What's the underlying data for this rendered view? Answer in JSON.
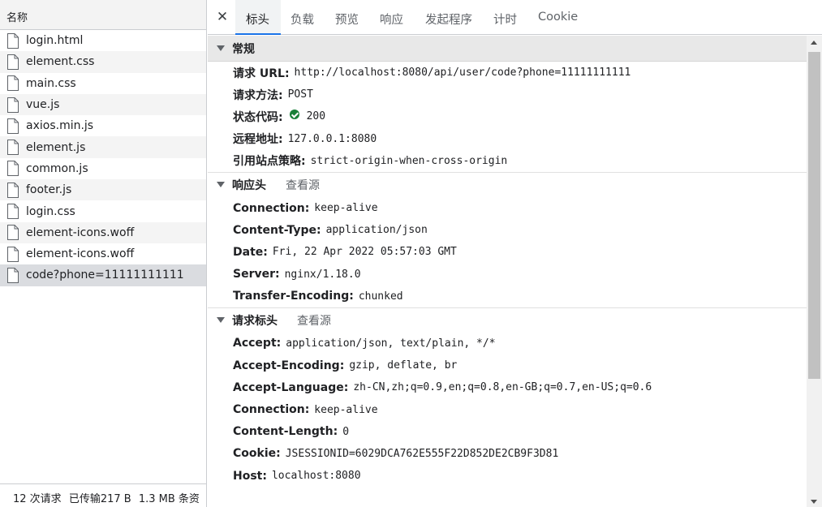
{
  "list": {
    "header": "名称",
    "files": [
      {
        "name": "login.html"
      },
      {
        "name": "element.css"
      },
      {
        "name": "main.css"
      },
      {
        "name": "vue.js"
      },
      {
        "name": "axios.min.js"
      },
      {
        "name": "element.js"
      },
      {
        "name": "common.js"
      },
      {
        "name": "footer.js"
      },
      {
        "name": "login.css"
      },
      {
        "name": "element-icons.woff"
      },
      {
        "name": "element-icons.woff"
      },
      {
        "name": "code?phone=11111111111"
      }
    ],
    "selected_index": 11,
    "status": {
      "requests": "12 次请求",
      "transferred": "已传输217 B",
      "resources": "1.3 MB 条资"
    }
  },
  "tabs": {
    "close_icon": "close-icon",
    "items": [
      {
        "label": "标头"
      },
      {
        "label": "负载"
      },
      {
        "label": "预览"
      },
      {
        "label": "响应"
      },
      {
        "label": "发起程序"
      },
      {
        "label": "计时"
      },
      {
        "label": "Cookie"
      }
    ],
    "active_index": 0
  },
  "general": {
    "title": "常规",
    "rows": [
      {
        "key": "请求 URL:",
        "value": "http://localhost:8080/api/user/code?phone=11111111111"
      },
      {
        "key": "请求方法:",
        "value": "POST"
      },
      {
        "key": "状态代码:",
        "value": "200",
        "icon": "status-ok-icon"
      },
      {
        "key": "远程地址:",
        "value": "127.0.0.1:8080"
      },
      {
        "key": "引用站点策略:",
        "value": "strict-origin-when-cross-origin"
      }
    ]
  },
  "response_headers": {
    "title": "响应头",
    "view_source": "查看源",
    "rows": [
      {
        "key": "Connection:",
        "value": "keep-alive"
      },
      {
        "key": "Content-Type:",
        "value": "application/json"
      },
      {
        "key": "Date:",
        "value": "Fri, 22 Apr 2022 05:57:03 GMT"
      },
      {
        "key": "Server:",
        "value": "nginx/1.18.0"
      },
      {
        "key": "Transfer-Encoding:",
        "value": "chunked"
      }
    ]
  },
  "request_headers": {
    "title": "请求标头",
    "view_source": "查看源",
    "rows": [
      {
        "key": "Accept:",
        "value": "application/json, text/plain, */*"
      },
      {
        "key": "Accept-Encoding:",
        "value": "gzip, deflate, br"
      },
      {
        "key": "Accept-Language:",
        "value": "zh-CN,zh;q=0.9,en;q=0.8,en-GB;q=0.7,en-US;q=0.6"
      },
      {
        "key": "Connection:",
        "value": "keep-alive"
      },
      {
        "key": "Content-Length:",
        "value": "0"
      },
      {
        "key": "Cookie:",
        "value": "JSESSIONID=6029DCA762E555F22D852DE2CB9F3D81"
      },
      {
        "key": "Host:",
        "value": "localhost:8080"
      }
    ]
  },
  "colors": {
    "accent": "#1a73e8",
    "status_ok": "#188038",
    "selected_row": "#dadce0"
  }
}
